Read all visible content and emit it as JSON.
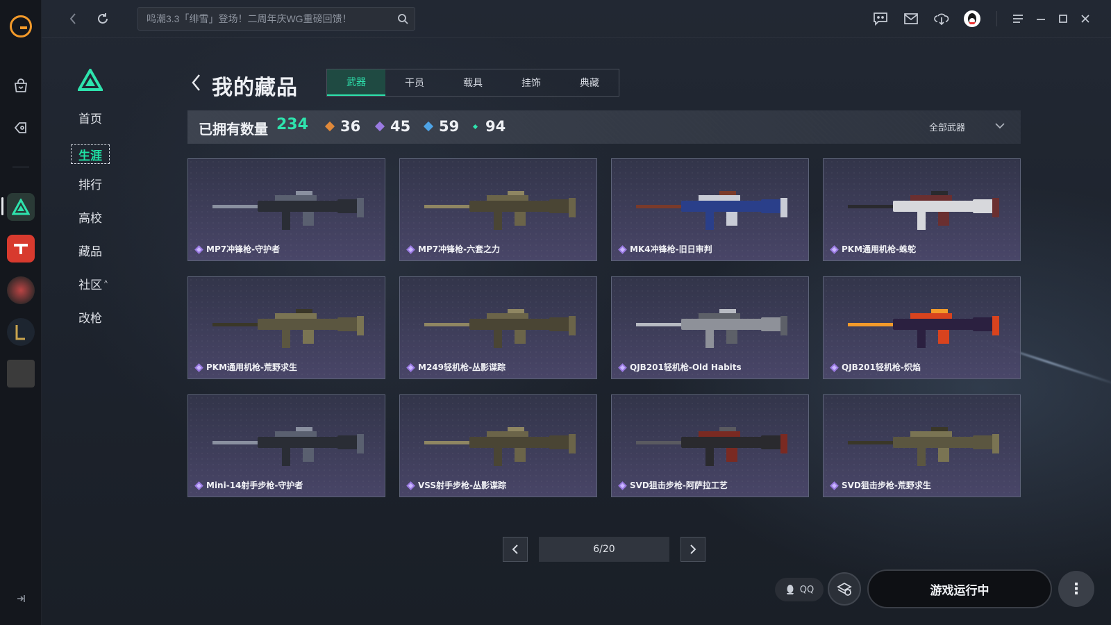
{
  "topbar": {
    "search_placeholder": "鸣潮3.3「绯雪」登场！二周年庆WG重磅回馈！"
  },
  "sidebar": {
    "items": [
      {
        "label": "首页",
        "active": false
      },
      {
        "label": "生涯",
        "active": true
      },
      {
        "label": "排行",
        "active": false
      },
      {
        "label": "高校",
        "active": false
      },
      {
        "label": "藏品",
        "active": false
      },
      {
        "label": "社区",
        "active": false,
        "caret": "^"
      },
      {
        "label": "改枪",
        "active": false
      }
    ]
  },
  "page": {
    "title": "我的藏品",
    "tabs": [
      "武器",
      "干员",
      "载具",
      "挂饰",
      "典藏"
    ],
    "active_tab": "武器"
  },
  "stats": {
    "owned_label": "已拥有数量",
    "owned_count": "234",
    "rarities": [
      {
        "value": "36",
        "color": "#e0893a"
      },
      {
        "value": "45",
        "color": "#9a7ae2"
      },
      {
        "value": "59",
        "color": "#4ea3e6"
      },
      {
        "value": "94",
        "color": "#2ee3ad"
      }
    ],
    "filter_label": "全部武器"
  },
  "items": [
    {
      "name": "MP7冲锋枪-守护者",
      "palette": "dark"
    },
    {
      "name": "MP7冲锋枪-六套之力",
      "palette": "camo"
    },
    {
      "name": "MK4冲锋枪-旧日审判",
      "palette": "blue"
    },
    {
      "name": "PKM通用机枪-蛛鸵",
      "palette": "white"
    },
    {
      "name": "PKM通用机枪-荒野求生",
      "palette": "olive"
    },
    {
      "name": "M249轻机枪-丛影谍踪",
      "palette": "camo"
    },
    {
      "name": "QJB201轻机枪-Old Habits",
      "palette": "grey"
    },
    {
      "name": "QJB201轻机枪-炽焰",
      "palette": "flame"
    },
    {
      "name": "Mini-14射手步枪-守护者",
      "palette": "dark"
    },
    {
      "name": "VSS射手步枪-丛影谍踪",
      "palette": "camo"
    },
    {
      "name": "SVD狙击步枪-阿萨拉工艺",
      "palette": "wood"
    },
    {
      "name": "SVD狙击步枪-荒野求生",
      "palette": "olive"
    }
  ],
  "pagination": {
    "current": "6/20"
  },
  "bottom": {
    "qq_label": "QQ",
    "run_label": "游戏运行中"
  }
}
